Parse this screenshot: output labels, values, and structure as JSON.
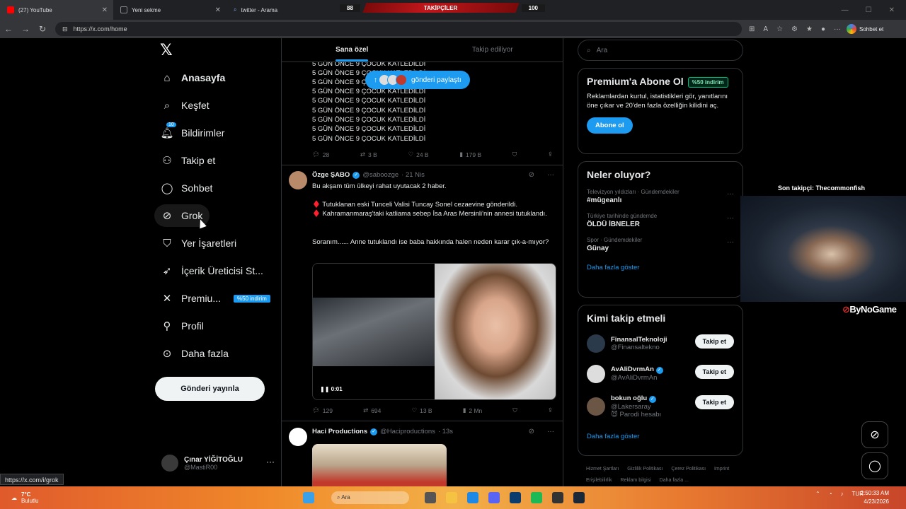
{
  "browser": {
    "tabs": [
      {
        "label": "(27) YouTube"
      },
      {
        "label": "Yeni sekme"
      },
      {
        "label": "twitter - Arama"
      }
    ],
    "stream_bar": {
      "left": "88",
      "center": "TAKİPÇİLER",
      "right": "100"
    },
    "url": "https://x.com/home",
    "chat_label": "Sohbet et",
    "status_url": "https://x.com/i/grok"
  },
  "nav": {
    "items": [
      {
        "label": "Anasayfa",
        "icon": "home-icon"
      },
      {
        "label": "Keşfet",
        "icon": "search-icon"
      },
      {
        "label": "Bildirimler",
        "icon": "bell-icon",
        "badge": "10"
      },
      {
        "label": "Takip et",
        "icon": "person-add-icon"
      },
      {
        "label": "Sohbet",
        "icon": "chat-icon"
      },
      {
        "label": "Grok",
        "icon": "grok-icon"
      },
      {
        "label": "Yer İşaretleri",
        "icon": "bookmark-icon"
      },
      {
        "label": "İçerik Üreticisi St...",
        "icon": "rocket-icon"
      },
      {
        "label": "Premiu...",
        "icon": "x-icon",
        "badge": "%50 indirim"
      },
      {
        "label": "Profil",
        "icon": "person-icon"
      },
      {
        "label": "Daha fazla",
        "icon": "more-icon"
      }
    ],
    "post_button": "Gönderi yayınla",
    "account": {
      "name": "Çınar YİĞİTOĞLU",
      "handle": "@MastiR00"
    }
  },
  "feed": {
    "tabs": [
      "Sana özel",
      "Takip ediliyor"
    ],
    "show_posts": "gönderi paylaştı",
    "repeat_line": "5 GÜN ÖNCE 9 ÇOCUK KATLEDİLDİ",
    "post1_actions": {
      "replies": "28",
      "reposts": "3 B",
      "likes": "24 B",
      "views": "179 B"
    },
    "post2": {
      "name": "Özge ŞABO",
      "handle": "@saboozge",
      "date": "· 21 Nis",
      "line1": "Bu akşam tüm ülkeyi rahat uyutacak 2 haber.",
      "line2": "♦️ Tutuklanan eski Tunceli Valisi Tuncay Sonel cezaevine gönderildi.",
      "line3": "♦️ Kahramanmaraş'taki katliama sebep İsa Aras Mersinli'nin annesi tutuklandı.",
      "line4": "Soranım...... Anne tutuklandı ise baba hakkında halen neden karar çık-a-mıyor?",
      "video_time": "0:01",
      "actions": {
        "replies": "129",
        "reposts": "694",
        "likes": "13 B",
        "views": "2 Mn"
      }
    },
    "post3": {
      "name": "Haci Productions",
      "handle": "@Haciproductions",
      "date": "· 13s"
    }
  },
  "sidebar": {
    "search_placeholder": "Ara",
    "premium": {
      "title": "Premium'a Abone Ol",
      "badge": "%50 indirim",
      "desc": "Reklamlardan kurtul, istatistikleri gör, yanıtlarını öne çıkar ve 20'den fazla özelliğin kilidini aç.",
      "button": "Abone ol"
    },
    "trends": {
      "title": "Neler oluyor?",
      "items": [
        {
          "cat": "Televizyon yıldızları · Gündemdekiler",
          "name": "#mügeanlı"
        },
        {
          "cat": "Türkiye tarihinde gündemde",
          "name": "ÖLDÜ İBNELER"
        },
        {
          "cat": "Spor · Gündemdekiler",
          "name": "Günay"
        }
      ],
      "more": "Daha fazla göster"
    },
    "who_to_follow": {
      "title": "Kimi takip etmeli",
      "items": [
        {
          "name": "FinansalTeknoloji",
          "handle": "@Finansaltekno",
          "button": "Takip et"
        },
        {
          "name": "AvAliDvrmAn",
          "handle": "@AvAliDvrmAn",
          "button": "Takip et"
        },
        {
          "name": "bokun oğlu",
          "handle": "@Lakersaray",
          "extra": "😈 Parodi hesabı",
          "button": "Takip et"
        }
      ],
      "more": "Daha fazla göster"
    },
    "footer": [
      "Hizmet Şartları",
      "Gizlilik Politikası",
      "Çerez Politikası",
      "Imprint",
      "Erişilebilirlik",
      "Reklam bilgisi",
      "Daha fazla ..."
    ]
  },
  "stream": {
    "last_follower": "Son takipçi: Thecommonfish",
    "brand": "ByNoGame"
  },
  "taskbar": {
    "weather_temp": "7°C",
    "weather_desc": "Bulutlu",
    "search": "Ara",
    "lang": "TUR",
    "time": "2:50:33 AM",
    "date": "4/23/2026"
  }
}
